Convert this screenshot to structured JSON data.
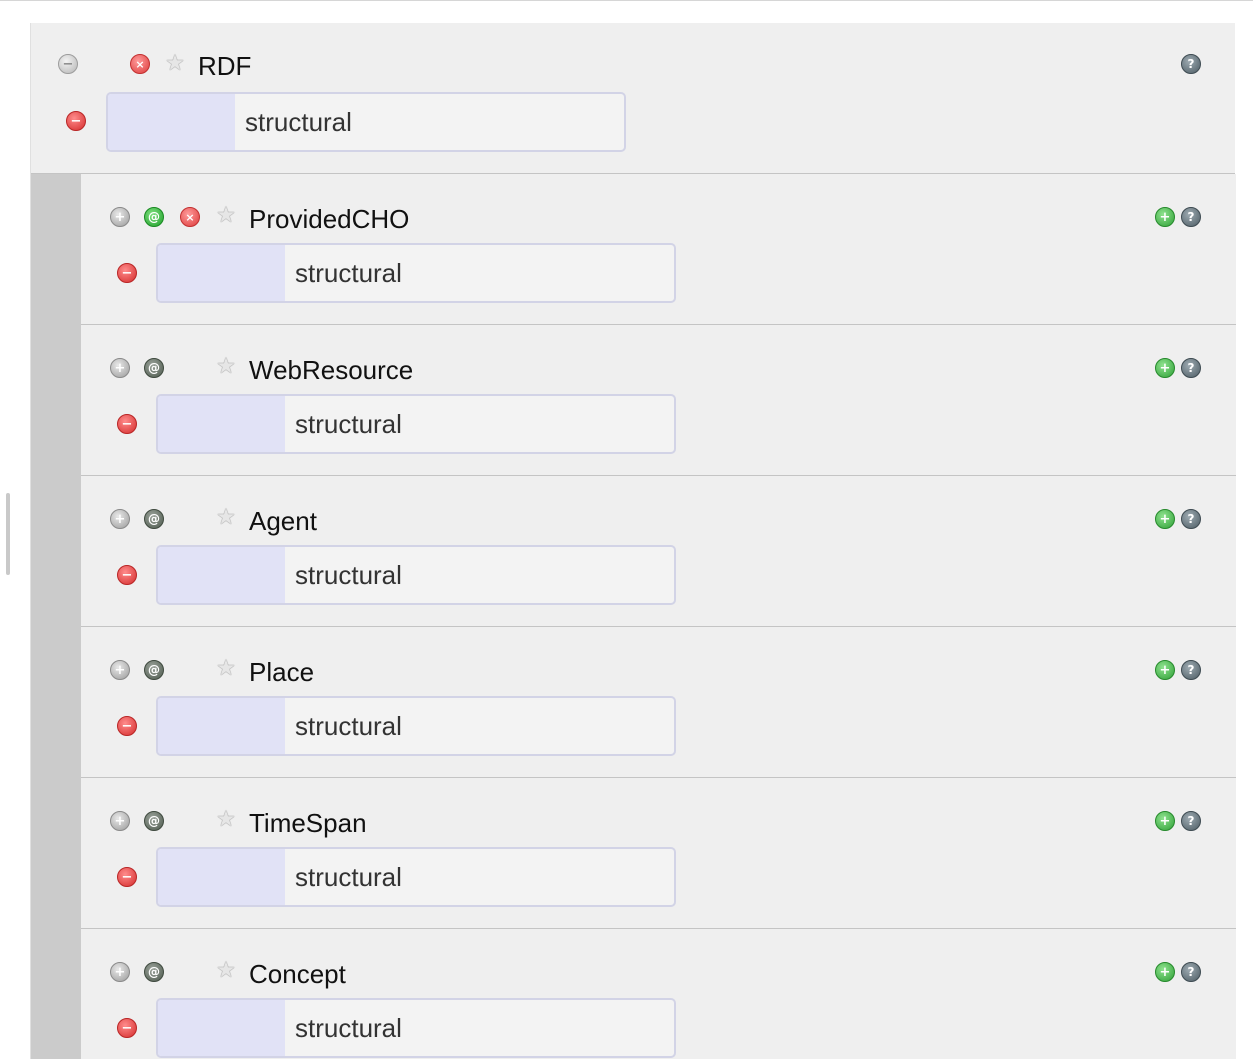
{
  "root": {
    "name": "RDF",
    "value": "structural",
    "icons": [
      "collapse-icon",
      "remove-icon",
      "star-icon",
      "help-icon",
      "remove-value-icon"
    ]
  },
  "children": [
    {
      "name": "ProvidedCHO",
      "value": "structural",
      "has_remove": true,
      "attr_active": true
    },
    {
      "name": "WebResource",
      "value": "structural",
      "has_remove": false,
      "attr_active": false
    },
    {
      "name": "Agent",
      "value": "structural",
      "has_remove": false,
      "attr_active": false
    },
    {
      "name": "Place",
      "value": "structural",
      "has_remove": false,
      "attr_active": false
    },
    {
      "name": "TimeSpan",
      "value": "structural",
      "has_remove": false,
      "attr_active": false
    },
    {
      "name": "Concept",
      "value": "structural",
      "has_remove": false,
      "attr_active": false
    }
  ],
  "glyphs": {
    "minus": "−",
    "plus": "+",
    "x": "×",
    "at": "@",
    "help": "?",
    "star": "★"
  },
  "colors": {
    "field_prefix": "#e1e2f6",
    "field_border": "#d2d3e6",
    "panel_bg": "#efefef",
    "indent_bar": "#cbcbcb"
  }
}
